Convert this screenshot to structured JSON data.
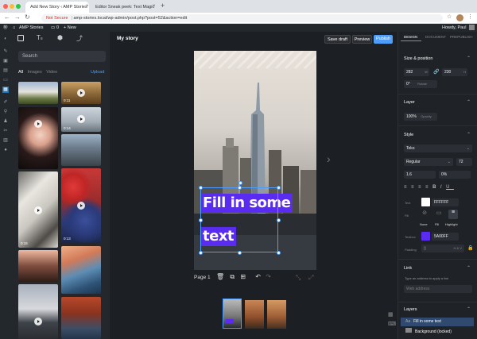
{
  "browser": {
    "tabs": [
      {
        "title": "Add New Story ‹ AMP Stories"
      },
      {
        "title": "Editor Sneak peek: Text Magic"
      }
    ],
    "url_prefix": "Not Secure",
    "url": "amp-stories.local/wp-admin/post.php?post=52&action=edit"
  },
  "adminbar": {
    "site_name": "AMP Stories",
    "comments_count": "0",
    "new_label": "+ New",
    "greeting": "Howdy, Paul"
  },
  "library": {
    "search_placeholder": "Search",
    "filters": [
      "All",
      "Images",
      "Video"
    ],
    "upload_label": "Upload",
    "durations": [
      "0:11",
      "0:14",
      "0:18",
      "0:13",
      "0:15",
      "0:15"
    ]
  },
  "editor": {
    "story_title": "My story",
    "save_draft": "Save draft",
    "preview": "Preview",
    "publish": "Publish",
    "text_line1": "Fill in some",
    "text_line2": "text",
    "page_label": "Page 1"
  },
  "panel": {
    "tabs": [
      "DESIGN",
      "DOCUMENT",
      "PREPUBLISH"
    ],
    "size_position": "Size & position",
    "width_value": "282",
    "width_label": "W",
    "height_value": "230",
    "height_label": "H",
    "rotate_value": "0°",
    "rotate_label": "Rotate",
    "layer": "Layer",
    "opacity_value": "100%",
    "opacity_label": "Opacity",
    "style": "Style",
    "font": "Teko",
    "weight": "Regular",
    "font_size": "72",
    "line_height": "1.6",
    "letter_spacing": "0%",
    "text_label": "Text",
    "text_color": "FFFFFF",
    "fill_label": "Fill",
    "fill_options": [
      "None",
      "Fill",
      "Highlight"
    ],
    "textbox_label": "Textbox",
    "textbox_color": "5A00FF",
    "padding_label": "Padding",
    "padding_value": "H & V",
    "link": "Link",
    "link_hint": "Type an address to apply a link",
    "link_placeholder": "Web address",
    "layers": "Layers",
    "layer_items": [
      "Fill in some text",
      "Background (locked)"
    ]
  },
  "colors": {
    "accent": "#4e9dfa",
    "text_fill": "#5a2bf0",
    "publish": "#4e9dfa"
  }
}
